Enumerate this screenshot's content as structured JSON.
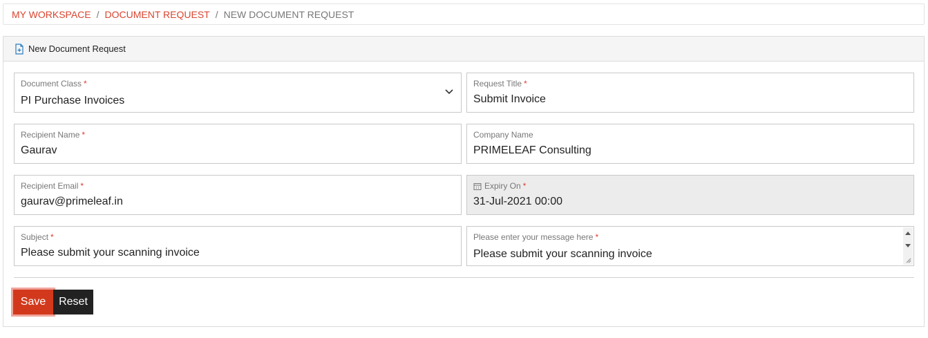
{
  "breadcrumb": {
    "items": [
      "MY WORKSPACE",
      "DOCUMENT REQUEST"
    ],
    "current": "NEW DOCUMENT REQUEST",
    "separator": "/"
  },
  "panel": {
    "title": "New Document Request"
  },
  "form": {
    "document_class": {
      "label": "Document Class",
      "required": "*",
      "value": "PI Purchase Invoices"
    },
    "request_title": {
      "label": "Request Title",
      "required": "*",
      "value": "Submit Invoice"
    },
    "recipient_name": {
      "label": "Recipient Name",
      "required": "*",
      "value": "Gaurav"
    },
    "company_name": {
      "label": "Company Name",
      "value": "PRIMELEAF Consulting"
    },
    "recipient_email": {
      "label": "Recipient Email",
      "required": "*",
      "value": "gaurav@primeleaf.in"
    },
    "expiry_on": {
      "label": "Expiry On",
      "required": "*",
      "value": "31-Jul-2021 00:00"
    },
    "subject": {
      "label": "Subject",
      "required": "*",
      "value": "Please submit your scanning invoice"
    },
    "message": {
      "label": "Please enter your message here",
      "required": "*",
      "value": "Please submit your scanning invoice"
    }
  },
  "buttons": {
    "save": "Save",
    "reset": "Reset"
  },
  "colors": {
    "accent": "#d9452f",
    "save_bg": "#d2391c",
    "reset_bg": "#222222"
  }
}
